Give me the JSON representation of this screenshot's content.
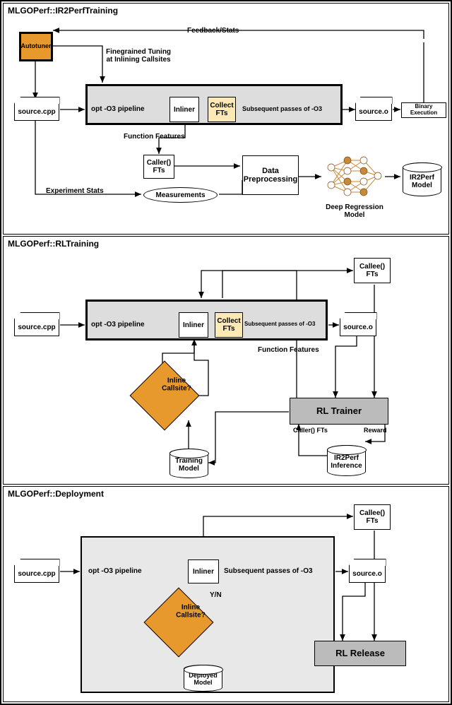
{
  "panel1": {
    "title": "MLGOPerf::IR2PerfTraining",
    "autotuner": "Autotuner",
    "feedback": "Feedback/Stats",
    "finegrained": "Finegrained Tuning\nat Inlining Callsites",
    "source_cpp": "source.cpp",
    "opt_pipeline": "opt -O3 pipeline",
    "inliner": "Inliner",
    "collect": "Collect\nFTs",
    "subsequent": "Subsequent passes of -O3",
    "source_o": "source.o",
    "binary_exec": "Binary Execution",
    "func_features": "Function Features",
    "caller_fts": "Caller()\nFTs",
    "experiment_stats": "Experiment Stats",
    "measurements": "Measurements",
    "data_preproc": "Data\nPreprocessing",
    "deep_regression": "Deep Regression\nModel",
    "ir2perf_model": "IR2Perf\nModel"
  },
  "panel2": {
    "title": "MLGOPerf::RLTraining",
    "source_cpp": "source.cpp",
    "opt_pipeline": "opt -O3 pipeline",
    "inliner": "Inliner",
    "collect": "Collect\nFTs",
    "subsequent": "Subsequent passes of -O3",
    "source_o": "source.o",
    "callee_fts": "Callee()\nFTs",
    "func_features": "Function Features",
    "inline_callsite": "Inline\nCallsite?",
    "training_model": "Training\nModel",
    "rl_trainer": "RL Trainer",
    "caller_fts": "Caller() FTs",
    "reward": "Reward",
    "ir2perf_inference": "IR2Perf\nInference"
  },
  "panel3": {
    "title": "MLGOPerf::Deployment",
    "source_cpp": "source.cpp",
    "opt_pipeline": "opt -O3 pipeline",
    "inliner": "Inliner",
    "subsequent": "Subsequent passes of -O3",
    "source_o": "source.o",
    "callee_fts": "Callee()\nFTs",
    "yn": "Y/N",
    "inline_callsite": "Inline\nCallsite?",
    "deployed_model": "Deployed\nModel",
    "rl_release": "RL Release"
  }
}
